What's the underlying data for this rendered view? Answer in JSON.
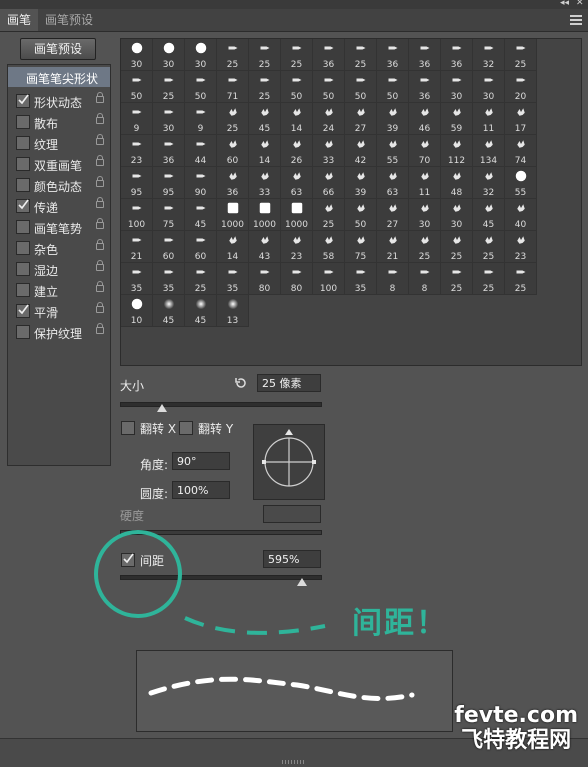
{
  "tabs": [
    {
      "label": "画笔"
    },
    {
      "label": "画笔预设"
    }
  ],
  "preset_button": "画笔预设",
  "sidebar": {
    "tip_label": "画笔笔尖形状",
    "items": [
      {
        "label": "形状动态",
        "checked": true
      },
      {
        "label": "散布",
        "checked": false
      },
      {
        "label": "纹理",
        "checked": false
      },
      {
        "label": "双重画笔",
        "checked": false
      },
      {
        "label": "颜色动态",
        "checked": false
      },
      {
        "label": "传递",
        "checked": true
      },
      {
        "label": "画笔笔势",
        "checked": false
      },
      {
        "label": "杂色",
        "checked": false
      },
      {
        "label": "湿边",
        "checked": false
      },
      {
        "label": "建立",
        "checked": false
      },
      {
        "label": "平滑",
        "checked": true
      },
      {
        "label": "保护纹理",
        "checked": false
      }
    ]
  },
  "brush_grid": [
    [
      "30",
      "30",
      "30",
      "25",
      "25",
      "25",
      "36",
      "25",
      "36",
      "36",
      "36",
      "32",
      "25"
    ],
    [
      "50",
      "25",
      "50",
      "71",
      "25",
      "50",
      "50",
      "50",
      "50",
      "36",
      "30",
      "30",
      "20"
    ],
    [
      "9",
      "30",
      "9",
      "25",
      "45",
      "14",
      "24",
      "27",
      "39",
      "46",
      "59",
      "11",
      "17"
    ],
    [
      "23",
      "36",
      "44",
      "60",
      "14",
      "26",
      "33",
      "42",
      "55",
      "70",
      "112",
      "134",
      "74"
    ],
    [
      "95",
      "95",
      "90",
      "36",
      "33",
      "63",
      "66",
      "39",
      "63",
      "11",
      "48",
      "32",
      "55"
    ],
    [
      "100",
      "75",
      "45",
      "1000",
      "1000",
      "1000",
      "25",
      "50",
      "27",
      "30",
      "30",
      "45",
      "40"
    ],
    [
      "21",
      "60",
      "60",
      "14",
      "43",
      "23",
      "58",
      "75",
      "21",
      "25",
      "25",
      "25",
      "23"
    ],
    [
      "35",
      "35",
      "25",
      "35",
      "80",
      "80",
      "100",
      "35",
      "8",
      "8",
      "25",
      "25",
      "25"
    ],
    [
      "10",
      "45",
      "45",
      "13"
    ]
  ],
  "size": {
    "label": "大小",
    "value": "25 像素",
    "fraction": 0.21
  },
  "flip_x": {
    "label": "翻转 X",
    "checked": false
  },
  "flip_y": {
    "label": "翻转 Y",
    "checked": false
  },
  "angle": {
    "label": "角度:",
    "value": "90°"
  },
  "roundness": {
    "label": "圆度:",
    "value": "100%"
  },
  "hardness": {
    "label": "硬度",
    "value": ""
  },
  "spacing": {
    "label": "间距",
    "value": "595%",
    "checked": true,
    "fraction": 0.91
  },
  "annotation": "间距！",
  "watermark": {
    "line1": "fevte.com",
    "line2": "飞特教程网"
  },
  "colors": {
    "accent": "#2fb49a",
    "panel": "#535353",
    "grid": "#3c3c3c"
  }
}
